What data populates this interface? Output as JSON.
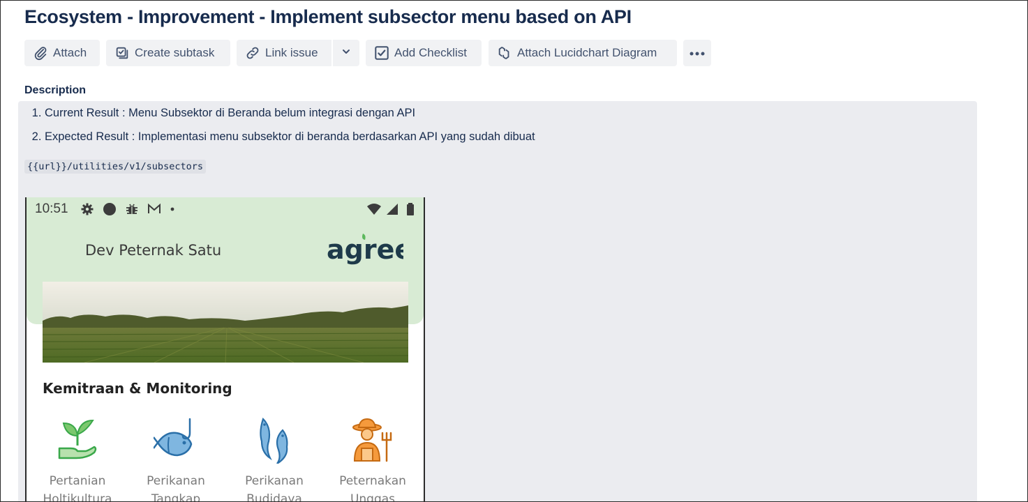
{
  "issue": {
    "title": "Ecosystem - Improvement - Implement subsector menu based on API"
  },
  "toolbar": {
    "attach": {
      "label": "Attach",
      "icon": "paperclip-icon"
    },
    "create_subtask": {
      "label": "Create subtask",
      "icon": "subtask-icon"
    },
    "link_issue": {
      "label": "Link issue",
      "icon": "link-icon"
    },
    "link_dropdown": {
      "icon": "chevron-down-icon"
    },
    "add_checklist": {
      "label": "Add Checklist",
      "icon": "checklist-icon"
    },
    "lucidchart": {
      "label": "Attach Lucidchart Diagram",
      "icon": "lucidchart-icon"
    },
    "more": {
      "icon": "more-icon"
    }
  },
  "description": {
    "label": "Description",
    "items": [
      "Current Result : Menu Subsektor di Beranda belum integrasi dengan API",
      "Expected Result : Implementasi menu subsektor di beranda berdasarkan API yang sudah dibuat"
    ],
    "code": "{{url}}/utilities/v1/subsectors"
  },
  "phone": {
    "status_time": "10:51",
    "user_name": "Dev Peternak Satu",
    "logo_text": "agree",
    "section_title": "Kemitraan & Monitoring",
    "categories": [
      {
        "line1": "Pertanian",
        "line2": "Holtikultura",
        "icon": "plant-hand-icon"
      },
      {
        "line1": "Perikanan",
        "line2": "Tangkap",
        "icon": "fish-hook-icon"
      },
      {
        "line1": "Perikanan",
        "line2": "Budidaya",
        "icon": "fish-pair-icon"
      },
      {
        "line1": "Peternakan",
        "line2": "Unggas",
        "icon": "farmer-icon"
      }
    ]
  },
  "colors": {
    "title": "#172b4d",
    "button_bg": "#f1f2f4",
    "description_bg": "#ebecf0",
    "phone_header_bg": "#d8ebd4",
    "logo": "#1e3a4a",
    "logo_leaf": "#5cb85c"
  }
}
